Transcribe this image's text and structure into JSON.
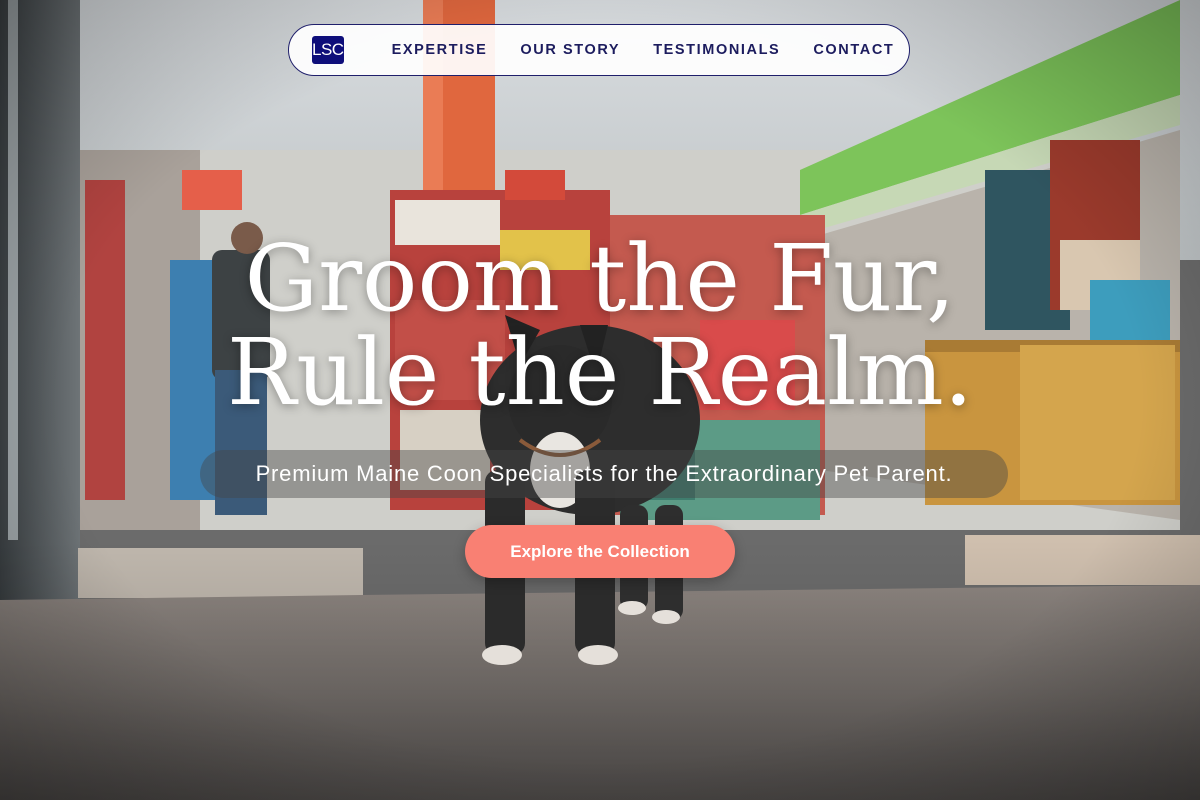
{
  "nav": {
    "logo_text": "LSC",
    "links": [
      {
        "label": "EXPERTISE"
      },
      {
        "label": "OUR STORY"
      },
      {
        "label": "TESTIMONIALS"
      },
      {
        "label": "CONTACT"
      }
    ]
  },
  "hero": {
    "headline_line1": "Groom the Fur,",
    "headline_line2": "Rule the Realm.",
    "subtitle": "Premium Maine Coon Specialists for the Extraordinary Pet Parent.",
    "cta_label": "Explore the Collection"
  },
  "colors": {
    "logo_bg": "#0e0e7a",
    "nav_text": "#1c1c5e",
    "cta_bg": "#f98073",
    "headline": "#ffffff"
  },
  "background_image": {
    "subject": "french-bulldog-in-pet-store-entrance"
  }
}
